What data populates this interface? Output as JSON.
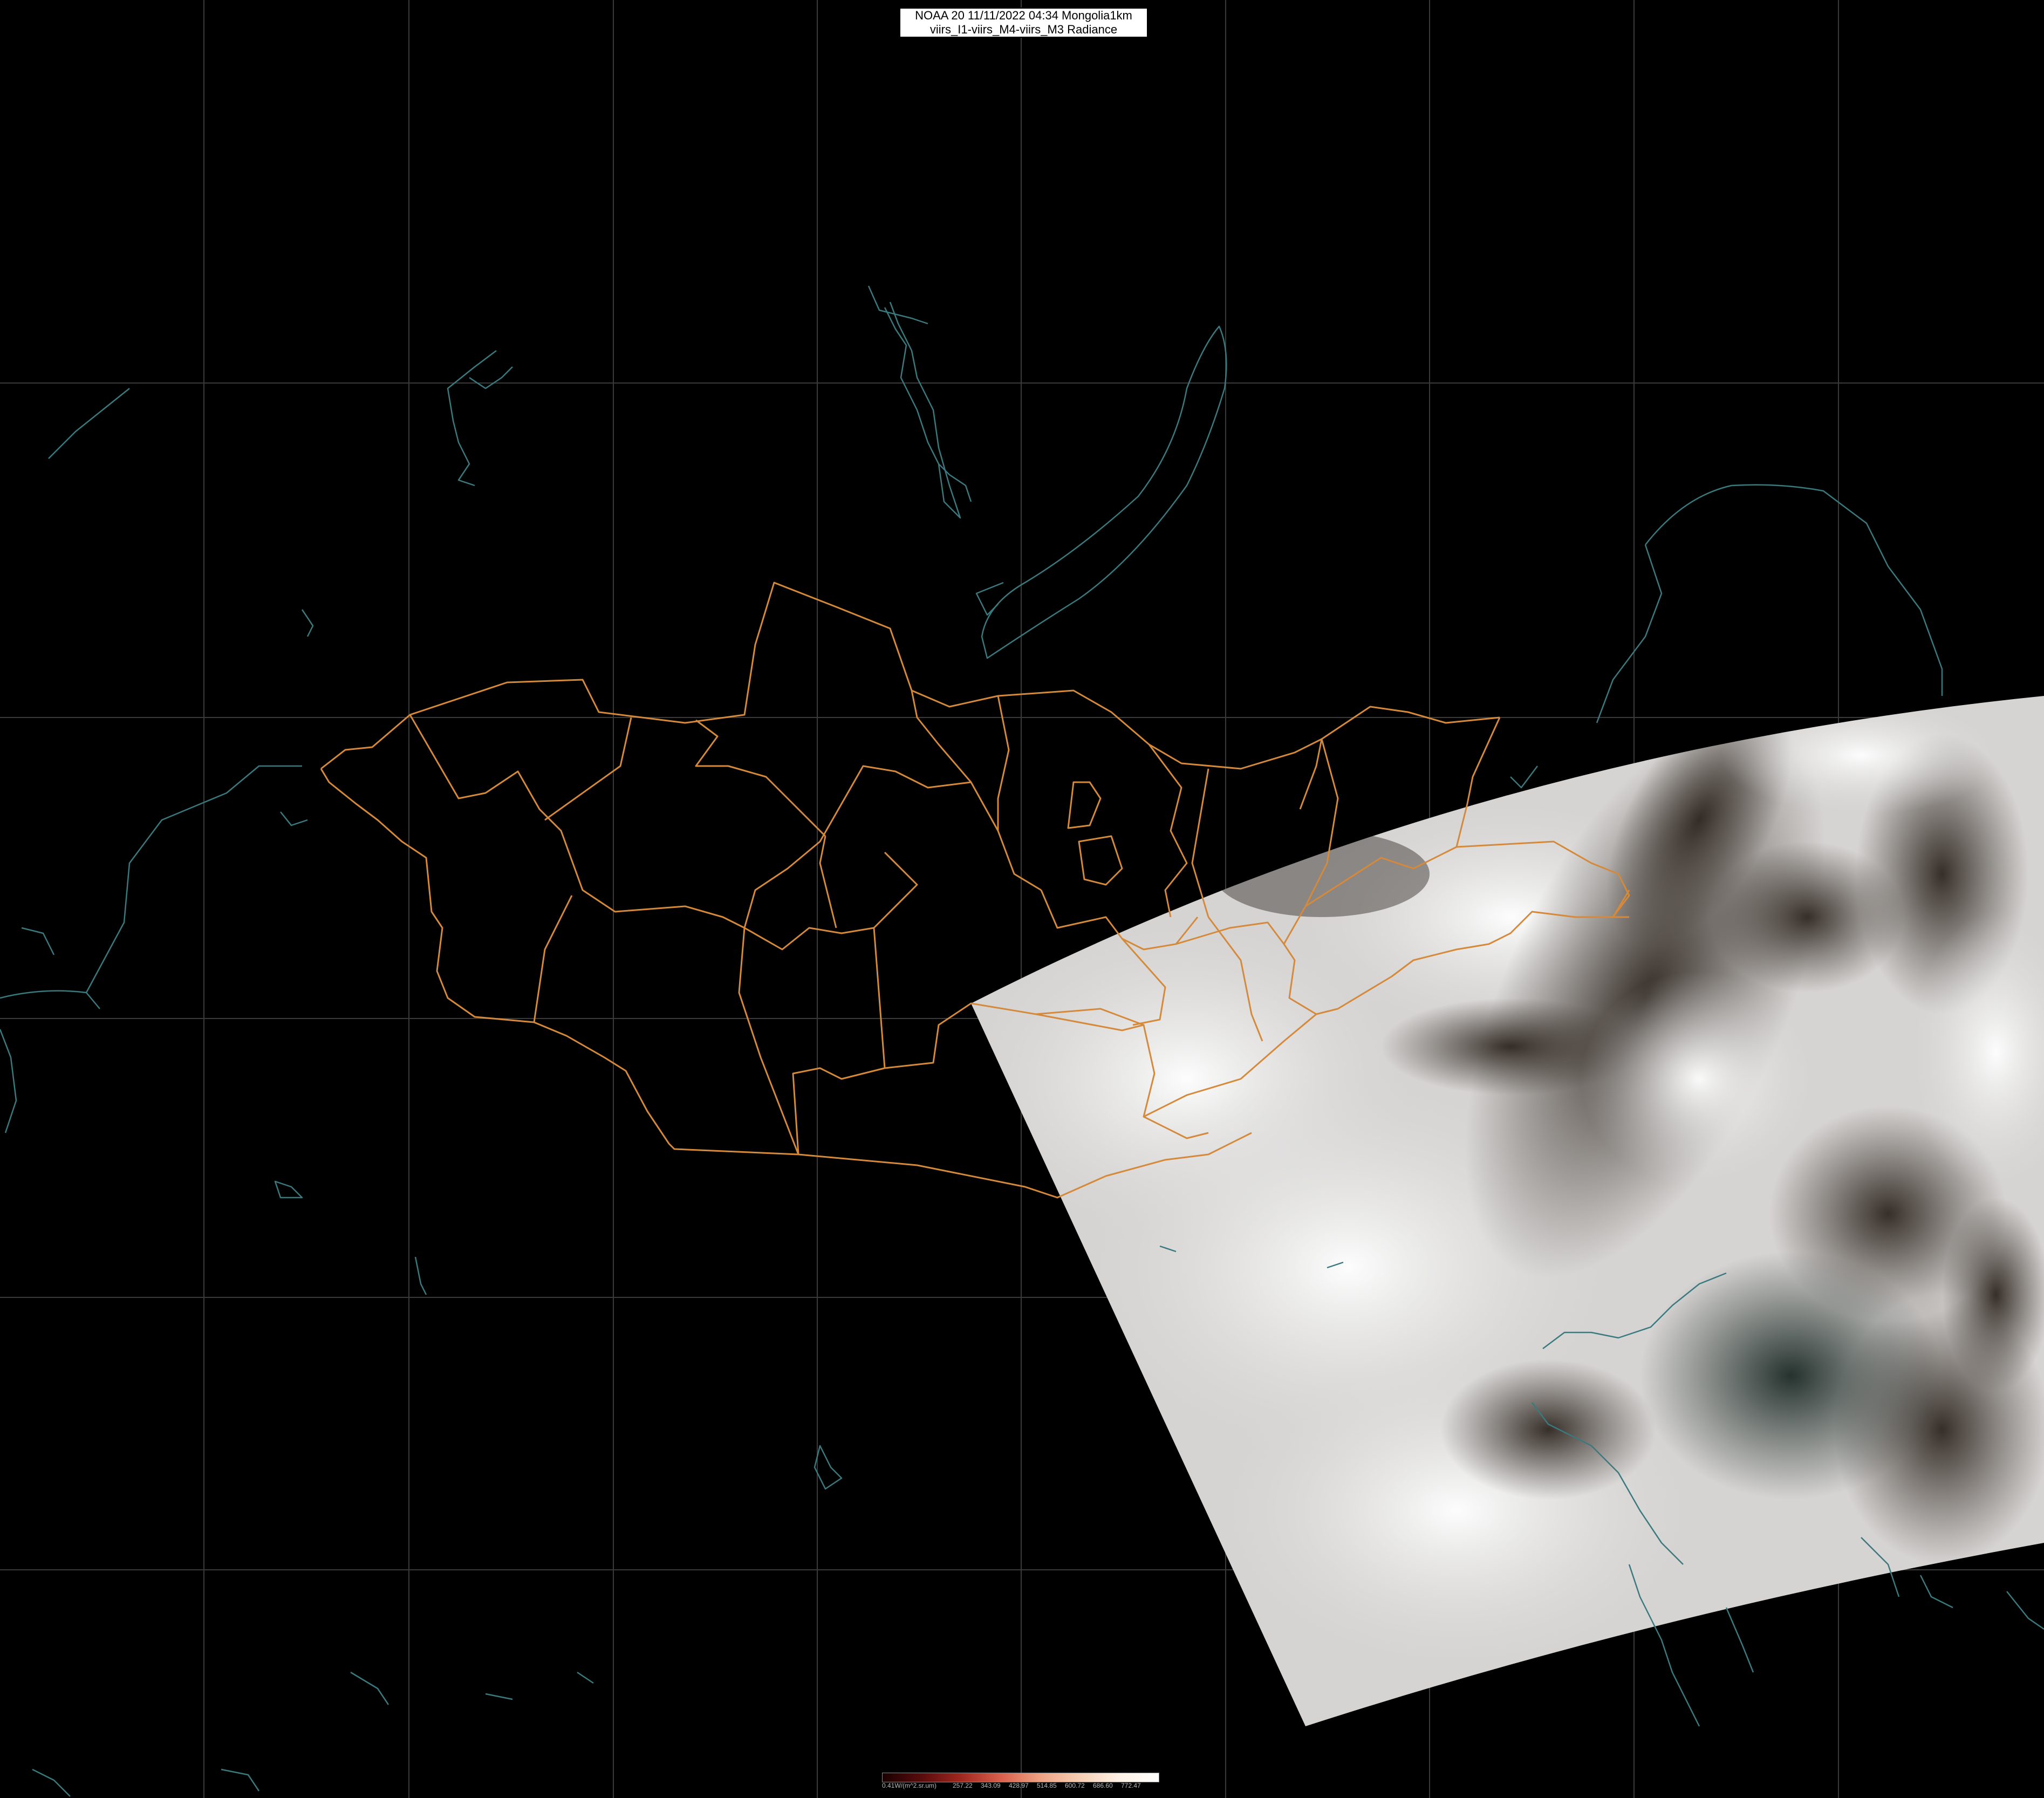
{
  "header": {
    "line1": "NOAA 20 11/11/2022 04:34 Mongolia1km",
    "line2": "viirs_I1-viirs_M4-viirs_M3 Radiance"
  },
  "colorbar": {
    "unit_label": "0.41W/(m^2.sr.um)",
    "ticks": [
      "257.22",
      "343.09",
      "428.97",
      "514.85",
      "600.72",
      "686.60",
      "772.47"
    ],
    "gradient": [
      "#1a0000",
      "#5a0c0c",
      "#a0281f",
      "#d8604c",
      "#eea284",
      "#f6cfb4",
      "#fdf1e4",
      "#ffffff"
    ]
  },
  "colors": {
    "background": "#000000",
    "province_border": "#d4893b",
    "coastline": "#3a7a7f",
    "graticule": "#3a3a3a"
  }
}
